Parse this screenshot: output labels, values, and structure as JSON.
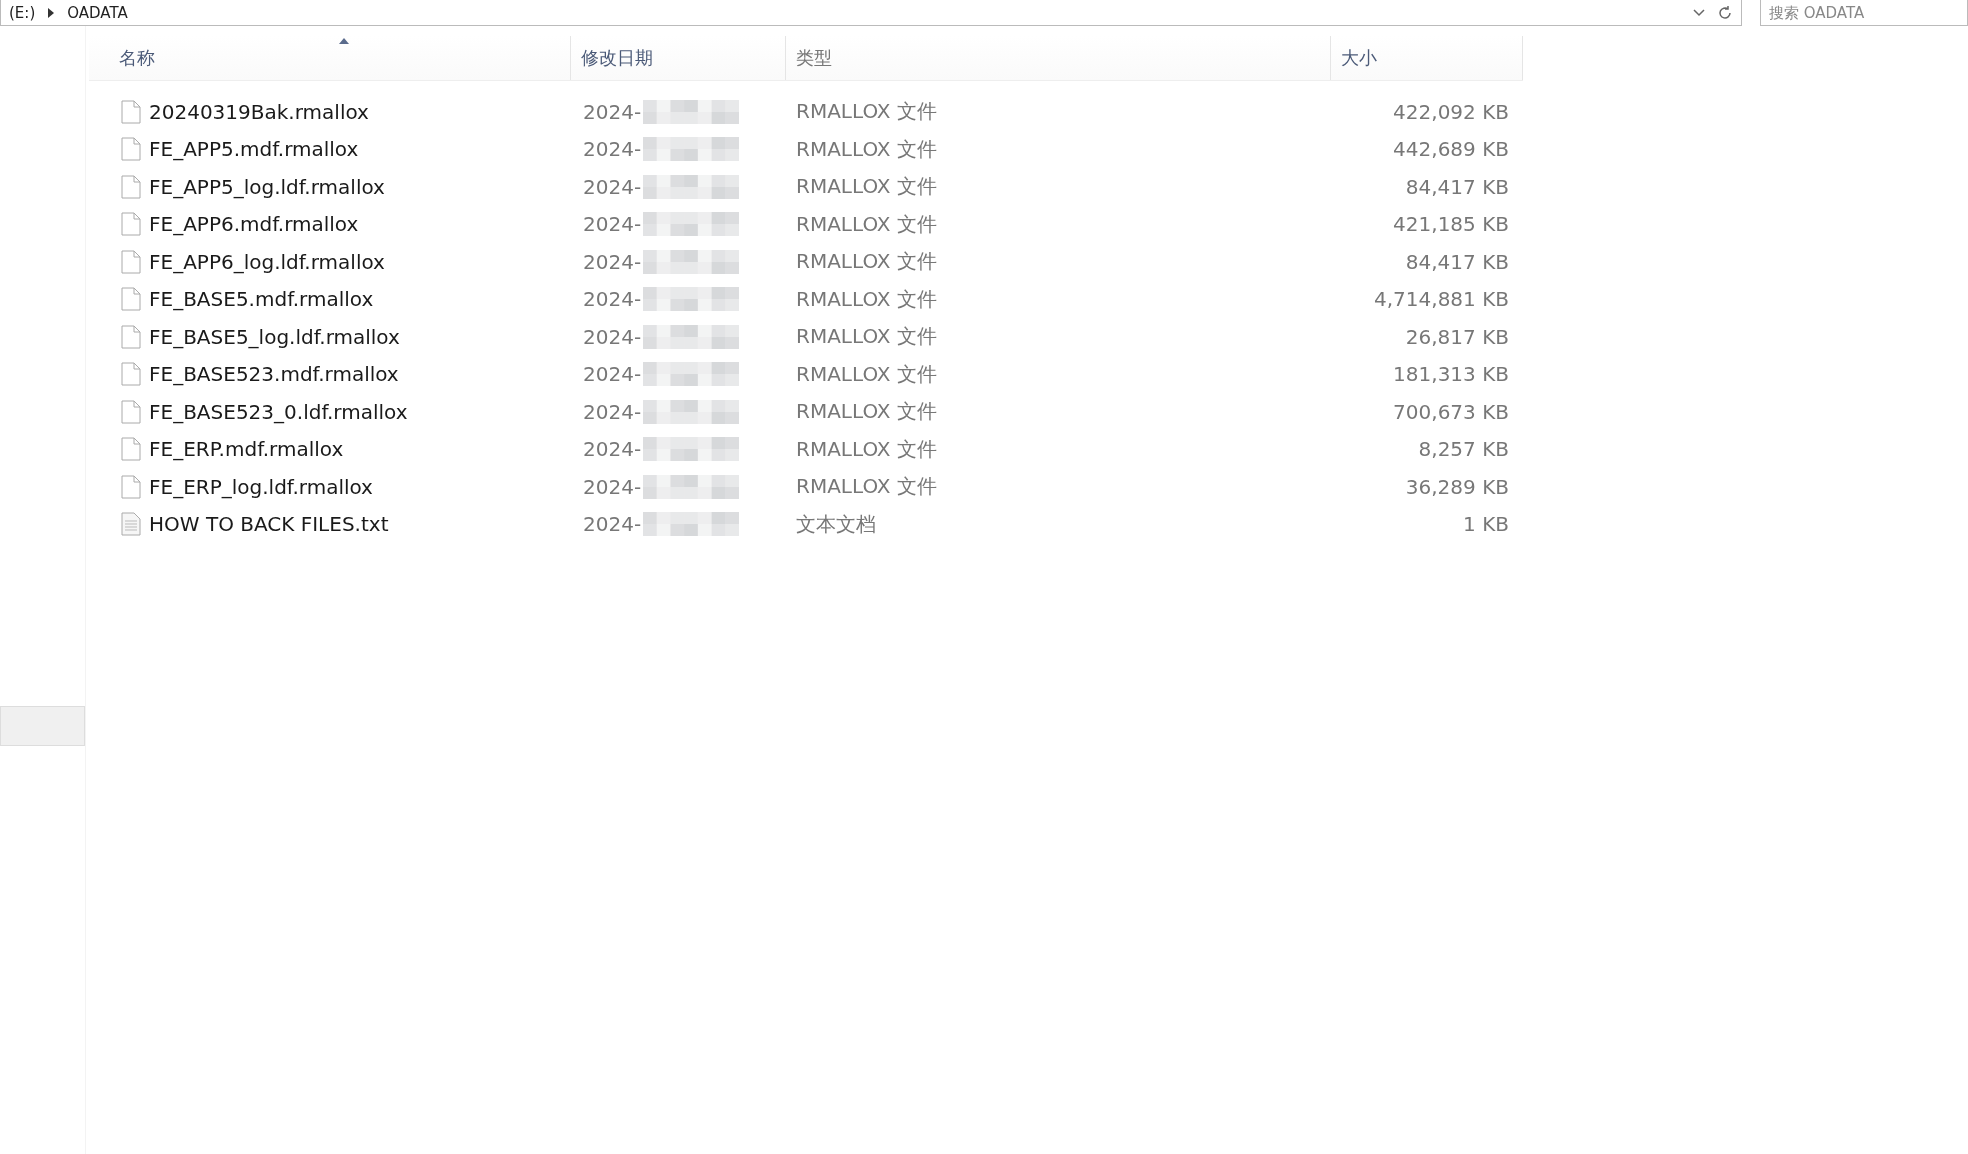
{
  "address_bar": {
    "drive": "(E:)",
    "folder": "OADATA"
  },
  "search": {
    "placeholder": "搜索 OADATA"
  },
  "columns": [
    {
      "label": "名称",
      "sorted": true
    },
    {
      "label": "修改日期",
      "sorted": false
    },
    {
      "label": "类型",
      "sorted": false
    },
    {
      "label": "大小",
      "sorted": false
    }
  ],
  "files": [
    {
      "name": "20240319Bak.rmallox",
      "date": "2024-",
      "type": "RMALLOX 文件",
      "size": "422,092 KB",
      "kind": "blank"
    },
    {
      "name": "FE_APP5.mdf.rmallox",
      "date": "2024-",
      "type": "RMALLOX 文件",
      "size": "442,689 KB",
      "kind": "blank"
    },
    {
      "name": "FE_APP5_log.ldf.rmallox",
      "date": "2024-",
      "type": "RMALLOX 文件",
      "size": "84,417 KB",
      "kind": "blank"
    },
    {
      "name": "FE_APP6.mdf.rmallox",
      "date": "2024-",
      "type": "RMALLOX 文件",
      "size": "421,185 KB",
      "kind": "blank"
    },
    {
      "name": "FE_APP6_log.ldf.rmallox",
      "date": "2024-",
      "type": "RMALLOX 文件",
      "size": "84,417 KB",
      "kind": "blank"
    },
    {
      "name": "FE_BASE5.mdf.rmallox",
      "date": "2024-",
      "type": "RMALLOX 文件",
      "size": "4,714,881 KB",
      "kind": "blank"
    },
    {
      "name": "FE_BASE5_log.ldf.rmallox",
      "date": "2024-",
      "type": "RMALLOX 文件",
      "size": "26,817 KB",
      "kind": "blank"
    },
    {
      "name": "FE_BASE523.mdf.rmallox",
      "date": "2024-",
      "type": "RMALLOX 文件",
      "size": "181,313 KB",
      "kind": "blank"
    },
    {
      "name": "FE_BASE523_0.ldf.rmallox",
      "date": "2024-",
      "type": "RMALLOX 文件",
      "size": "700,673 KB",
      "kind": "blank"
    },
    {
      "name": "FE_ERP.mdf.rmallox",
      "date": "2024-",
      "type": "RMALLOX 文件",
      "size": "8,257 KB",
      "kind": "blank"
    },
    {
      "name": "FE_ERP_log.ldf.rmallox",
      "date": "2024-",
      "type": "RMALLOX 文件",
      "size": "36,289 KB",
      "kind": "blank"
    },
    {
      "name": "HOW TO BACK FILES.txt",
      "date": "2024-",
      "type": "文本文档",
      "size": "1 KB",
      "kind": "text"
    }
  ],
  "sidebar": {
    "items": [
      {
        "selected": true
      }
    ]
  }
}
